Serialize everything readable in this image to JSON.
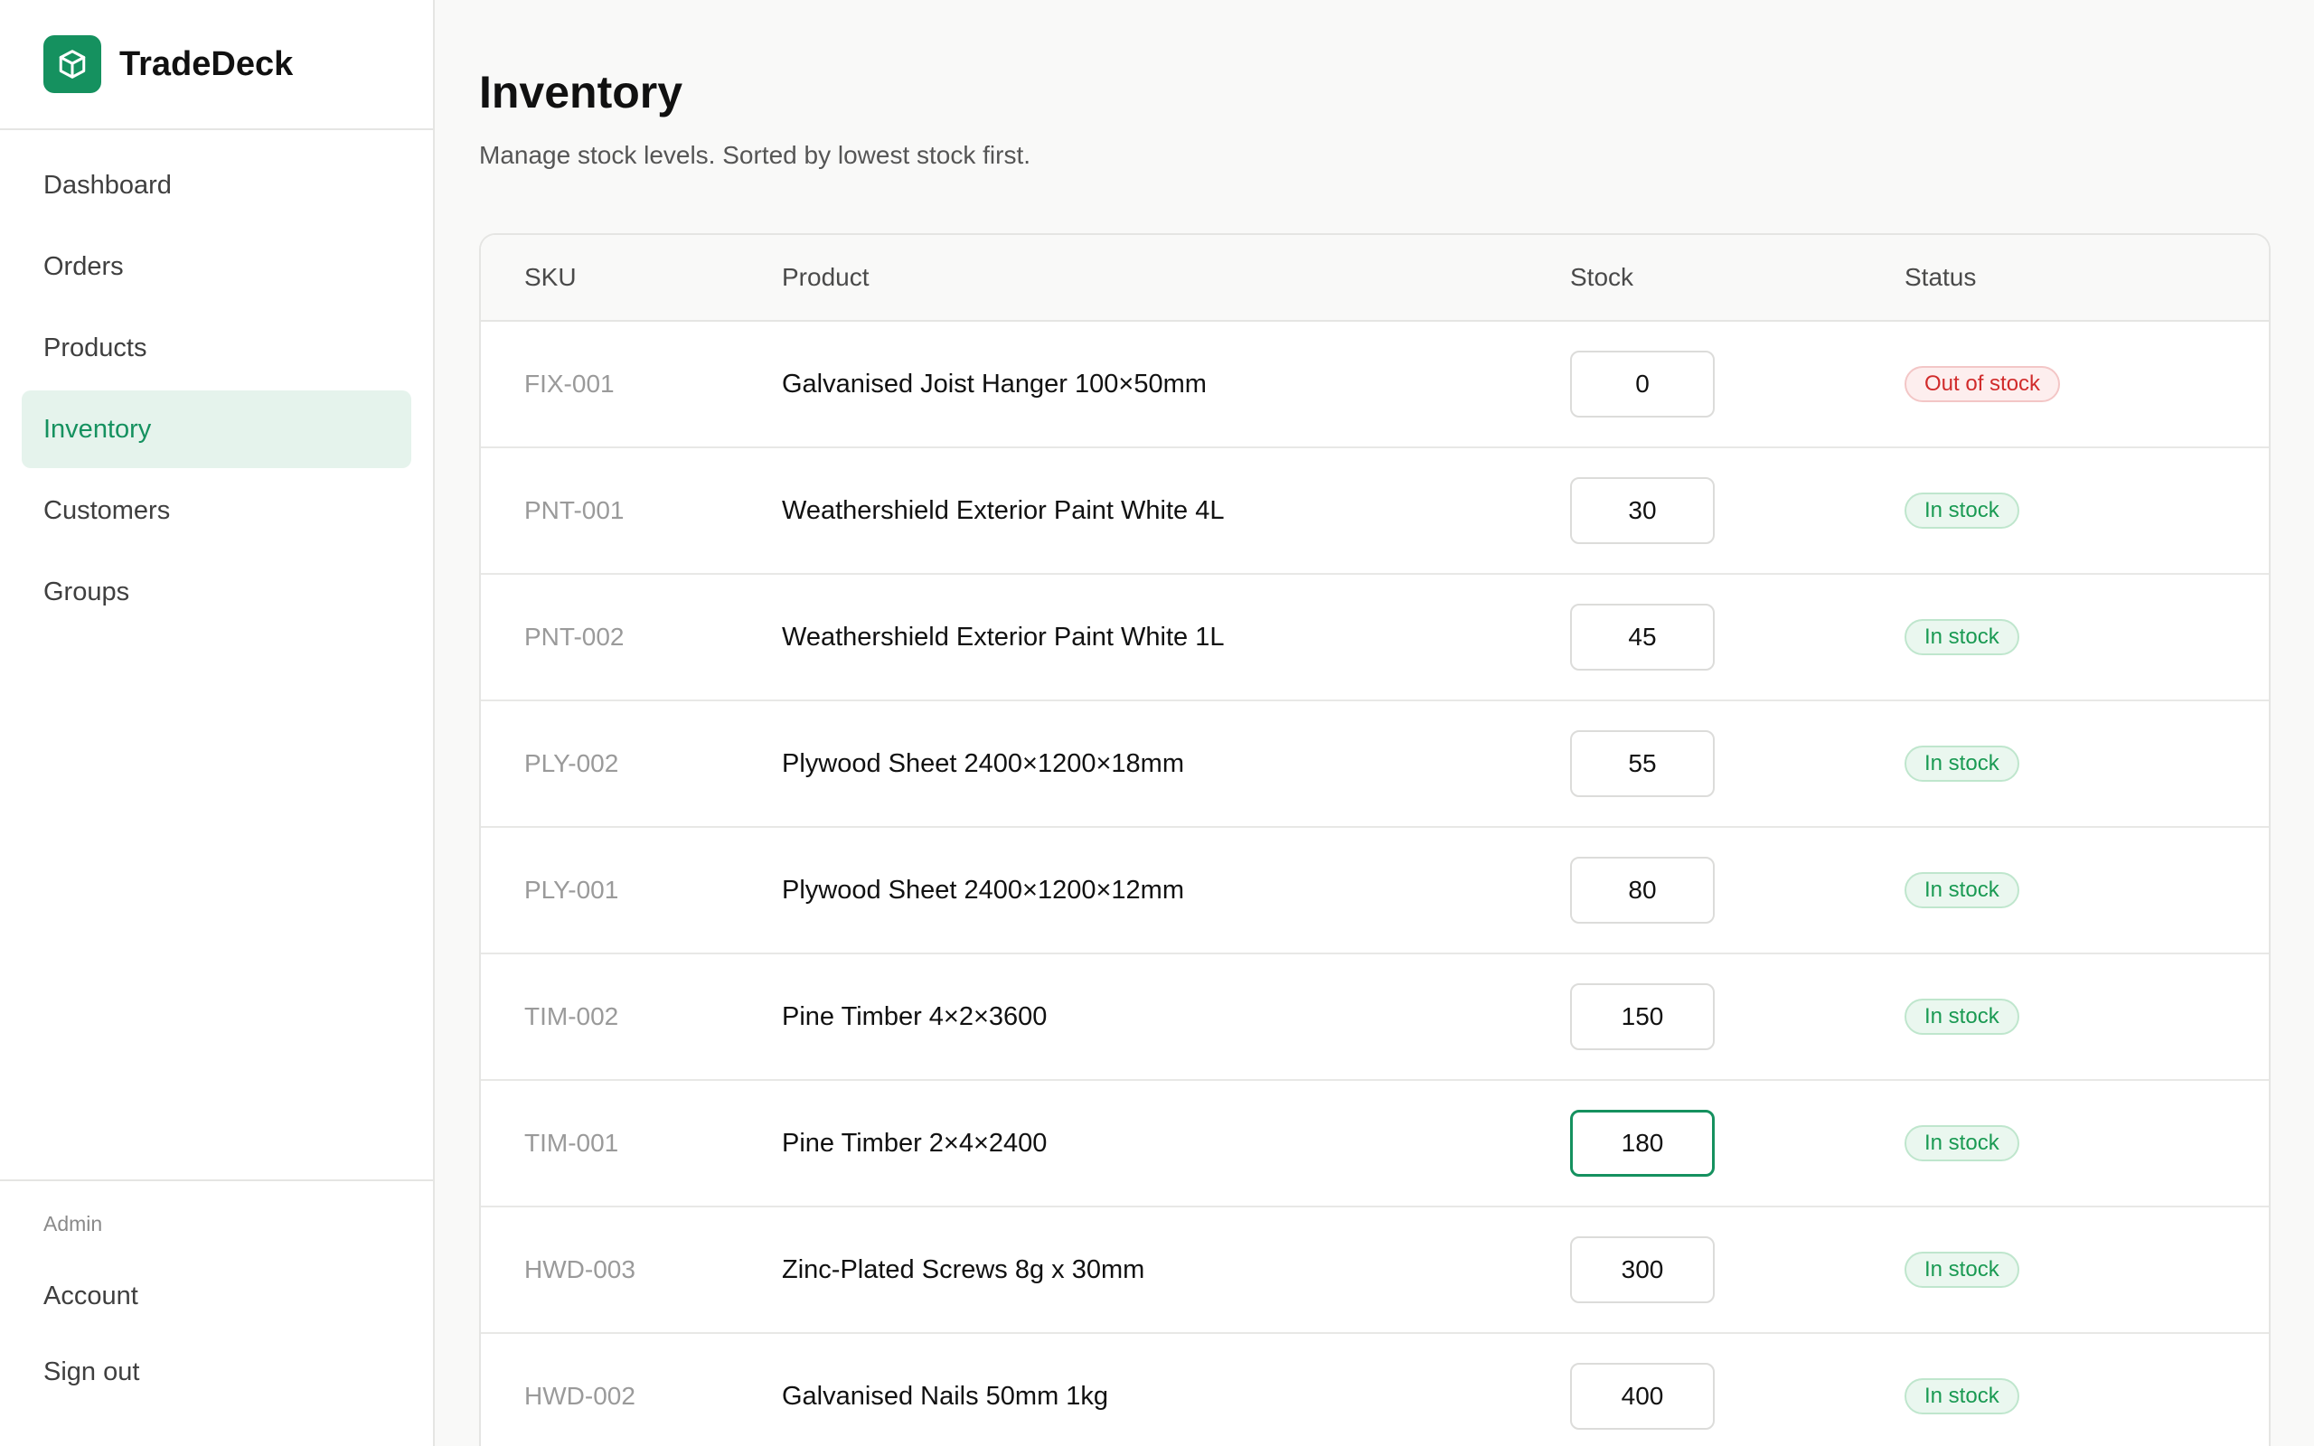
{
  "app": {
    "name": "TradeDeck",
    "logo_icon": "cube-icon",
    "accent": "#15915f"
  },
  "sidebar": {
    "items": [
      {
        "label": "Dashboard",
        "active": false
      },
      {
        "label": "Orders",
        "active": false
      },
      {
        "label": "Products",
        "active": false
      },
      {
        "label": "Inventory",
        "active": true
      },
      {
        "label": "Customers",
        "active": false
      },
      {
        "label": "Groups",
        "active": false
      }
    ],
    "admin_label": "Admin",
    "account": "Account",
    "signout": "Sign out"
  },
  "page": {
    "title": "Inventory",
    "subtitle": "Manage stock levels. Sorted by lowest stock first."
  },
  "table": {
    "headers": {
      "sku": "SKU",
      "product": "Product",
      "stock": "Stock",
      "status": "Status"
    },
    "rows": [
      {
        "sku": "FIX-001",
        "product": "Galvanised Joist Hanger 100×50mm",
        "stock": "0",
        "status": "Out of stock",
        "status_type": "out"
      },
      {
        "sku": "PNT-001",
        "product": "Weathershield Exterior Paint White 4L",
        "stock": "30",
        "status": "In stock",
        "status_type": "in"
      },
      {
        "sku": "PNT-002",
        "product": "Weathershield Exterior Paint White 1L",
        "stock": "45",
        "status": "In stock",
        "status_type": "in"
      },
      {
        "sku": "PLY-002",
        "product": "Plywood Sheet 2400×1200×18mm",
        "stock": "55",
        "status": "In stock",
        "status_type": "in"
      },
      {
        "sku": "PLY-001",
        "product": "Plywood Sheet 2400×1200×12mm",
        "stock": "80",
        "status": "In stock",
        "status_type": "in"
      },
      {
        "sku": "TIM-002",
        "product": "Pine Timber 4×2×3600",
        "stock": "150",
        "status": "In stock",
        "status_type": "in"
      },
      {
        "sku": "TIM-001",
        "product": "Pine Timber 2×4×2400",
        "stock": "180",
        "status": "In stock",
        "status_type": "in",
        "focused": true
      },
      {
        "sku": "HWD-003",
        "product": "Zinc-Plated Screws 8g x 30mm",
        "stock": "300",
        "status": "In stock",
        "status_type": "in"
      },
      {
        "sku": "HWD-002",
        "product": "Galvanised Nails 50mm 1kg",
        "stock": "400",
        "status": "In stock",
        "status_type": "in"
      }
    ]
  }
}
